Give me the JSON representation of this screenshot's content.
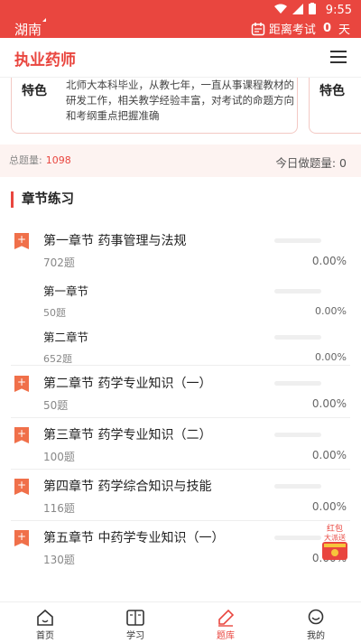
{
  "status_bar": {
    "region": "湖南",
    "time": "9:55",
    "exam_label": "距离考试",
    "exam_days": "0",
    "exam_unit": "天"
  },
  "header": {
    "title": "执业药师"
  },
  "teacher_card": {
    "feature_label": "特色",
    "description": "北师大本科毕业，从教七年，一直从事课程教材的研发工作，相关教学经验丰富，对考试的命题方向和考纲重点把握准确",
    "next_feature_label": "特色"
  },
  "stats": {
    "total_label": "总题量:",
    "total_value": "1098",
    "today_label": "今日做题量: 0"
  },
  "section": {
    "title": "章节练习"
  },
  "chapters": [
    {
      "name": "第一章节 药事管理与法规",
      "count": "702题",
      "percent": "0.00%",
      "progress": 0
    },
    {
      "name": "第一章节",
      "count": "50题",
      "percent": "0.00%",
      "progress": 0
    },
    {
      "name": "第二章节",
      "count": "652题",
      "percent": "0.00%",
      "progress": 0
    },
    {
      "name": "第二章节 药学专业知识（一）",
      "count": "50题",
      "percent": "0.00%",
      "progress": 0
    },
    {
      "name": "第三章节 药学专业知识（二）",
      "count": "100题",
      "percent": "0.00%",
      "progress": 0
    },
    {
      "name": "第四章节 药学综合知识与技能",
      "count": "116题",
      "percent": "0.00%",
      "progress": 0
    },
    {
      "name": "第五章节 中药学专业知识（一）",
      "count": "130题",
      "percent": "0.00%",
      "progress": 0
    }
  ],
  "promo": {
    "text_top": "红包",
    "text_bottom": "大派送"
  },
  "tabs": [
    {
      "label": "首页",
      "icon": "home-icon"
    },
    {
      "label": "学习",
      "icon": "book-icon"
    },
    {
      "label": "题库",
      "icon": "pencil-icon",
      "active": true
    },
    {
      "label": "我的",
      "icon": "profile-icon"
    }
  ],
  "colors": {
    "accent": "#e9463f",
    "chapter_badge": "#f0704a",
    "stats_bg": "#fdf3f1"
  }
}
